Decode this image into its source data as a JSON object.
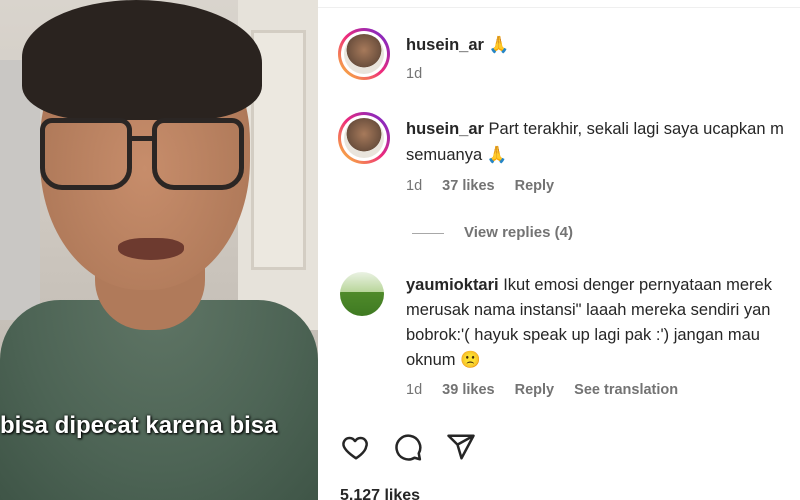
{
  "video": {
    "caption": "bisa dipecat karena bisa"
  },
  "post": {
    "author": "husein_ar",
    "author_emoji": "🙏",
    "time": "1d"
  },
  "comments": [
    {
      "user": "husein_ar",
      "lines": [
        "Part terakhir, sekali lagi saya ucapkan m",
        "semuanya 🙏"
      ],
      "time": "1d",
      "likes": "37 likes",
      "reply": "Reply"
    },
    {
      "user": "yaumioktari",
      "lines": [
        "Ikut emosi denger pernyataan merek",
        "merusak nama instansi\" laaah mereka sendiri yan",
        "bobrok:'( hayuk speak up lagi pak :') jangan mau",
        "oknum 🙁"
      ],
      "time": "1d",
      "likes": "39 likes",
      "reply": "Reply",
      "translation": "See translation"
    }
  ],
  "view_replies": "View replies (4)",
  "likes_count": "5,127 likes",
  "icons": [
    "heart-icon",
    "comment-icon",
    "share-icon"
  ]
}
